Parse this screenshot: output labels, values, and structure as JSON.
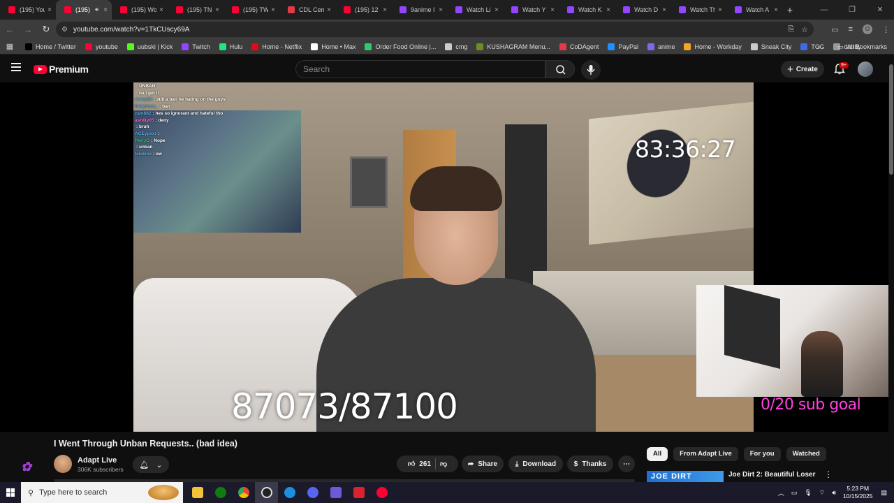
{
  "browser": {
    "tabs": [
      {
        "label": "(195) You",
        "favicon": "youtube",
        "active": false
      },
      {
        "label": "(195)",
        "favicon": "youtube",
        "active": true,
        "muted_icon": "speaker-icon"
      },
      {
        "label": "(195) Wo",
        "favicon": "youtube",
        "active": false
      },
      {
        "label": "(195) TN",
        "favicon": "youtube",
        "active": false
      },
      {
        "label": "(195) TW",
        "favicon": "youtube",
        "active": false
      },
      {
        "label": "CDL Cent",
        "favicon": "cdl",
        "active": false
      },
      {
        "label": "(195) 12",
        "favicon": "youtube",
        "active": false
      },
      {
        "label": "9anime I",
        "favicon": "twitch",
        "active": false
      },
      {
        "label": "Watch Li",
        "favicon": "twitch",
        "active": false
      },
      {
        "label": "Watch Y",
        "favicon": "twitch",
        "active": false
      },
      {
        "label": "Watch K",
        "favicon": "twitch",
        "active": false
      },
      {
        "label": "Watch D",
        "favicon": "twitch",
        "active": false
      },
      {
        "label": "Watch Th",
        "favicon": "twitch",
        "active": false
      },
      {
        "label": "Watch A",
        "favicon": "twitch",
        "active": false
      }
    ],
    "close_glyph": "×",
    "new_tab_glyph": "+",
    "url": "youtube.com/watch?v=1TkCUscy69A",
    "bookmarks": [
      {
        "label": "Home / Twitter",
        "color": "#000000"
      },
      {
        "label": "youtube",
        "color": "#ff0033"
      },
      {
        "label": "uubski | Kick",
        "color": "#53fc18"
      },
      {
        "label": "Twitch",
        "color": "#9146ff"
      },
      {
        "label": "Hulu",
        "color": "#1ce783"
      },
      {
        "label": "Home - Netflix",
        "color": "#e50914"
      },
      {
        "label": "Home • Max",
        "color": "#ffffff"
      },
      {
        "label": "Order Food Online |...",
        "color": "#2ecc71"
      },
      {
        "label": "cmg",
        "color": "#cccccc"
      },
      {
        "label": "KUSHAGRAM Menu...",
        "color": "#6b8e23"
      },
      {
        "label": "CoDAgent",
        "color": "#e63946"
      },
      {
        "label": "PayPal",
        "color": "#1e90ff"
      },
      {
        "label": "anime",
        "color": "#7b68ee"
      },
      {
        "label": "Home - Workday",
        "color": "#f5a623"
      },
      {
        "label": "Sneak City",
        "color": "#cccccc"
      },
      {
        "label": "TCG",
        "color": "#4169e1"
      },
      {
        "label": "dubby",
        "color": "#999999"
      }
    ],
    "all_bookmarks": "All Bookmarks",
    "profile_initial": "O"
  },
  "youtube": {
    "logo_text": "Premium",
    "search_placeholder": "Search",
    "create_label": "Create",
    "notification_badge": "9+"
  },
  "video_overlay": {
    "chat": [
      {
        "user": "",
        "msg": ": UNBAN",
        "color": "#4cd137"
      },
      {
        "user": "",
        "msg": ": na i get it",
        "color": "#ff4d4d"
      },
      {
        "user": "everythi",
        "msg": ": still a ban he hating on the guys",
        "color": "#5dade2"
      },
      {
        "user": "Delyrious_",
        "msg": ": ban",
        "color": "#5dade2"
      },
      {
        "user": "zam882",
        "msg": ": hes so ignorant and hateful tho",
        "color": "#5dade2"
      },
      {
        "user": "ashlily05",
        "msg": ": deny",
        "color": "#ff66cc"
      },
      {
        "user": "",
        "msg": ": bruh",
        "color": "#5dade2"
      },
      {
        "user": "ACEypxxr",
        "msg": ":",
        "color": "#5dade2"
      },
      {
        "user": "PerryD",
        "msg": ": Nope",
        "color": "#2ecc71"
      },
      {
        "user": "",
        "msg": ": unban",
        "color": "#ff66cc"
      },
      {
        "user": "telekinx",
        "msg": ": ew",
        "color": "#5dade2"
      }
    ],
    "timer": "83:36:27",
    "counter": "87073/87100",
    "sub_goal": "0/20 sub goal"
  },
  "video": {
    "title": "I Went Through Unban Requests.. (bad idea)",
    "channel": "Adapt Live",
    "subscribers": "306K subscribers",
    "likes": "261",
    "share_label": "Share",
    "download_label": "Download",
    "thanks_label": "Thanks",
    "more_glyph": "⋯"
  },
  "recommendations": {
    "chips": [
      "All",
      "From Adapt Live",
      "For you",
      "Watched"
    ],
    "first_title": "Joe Dirt 2: Beautiful Loser",
    "thumb_text": "JOE DIRT"
  },
  "taskbar": {
    "search_placeholder": "Type here to search",
    "time": "5:23 PM",
    "date": "10/15/2025"
  }
}
